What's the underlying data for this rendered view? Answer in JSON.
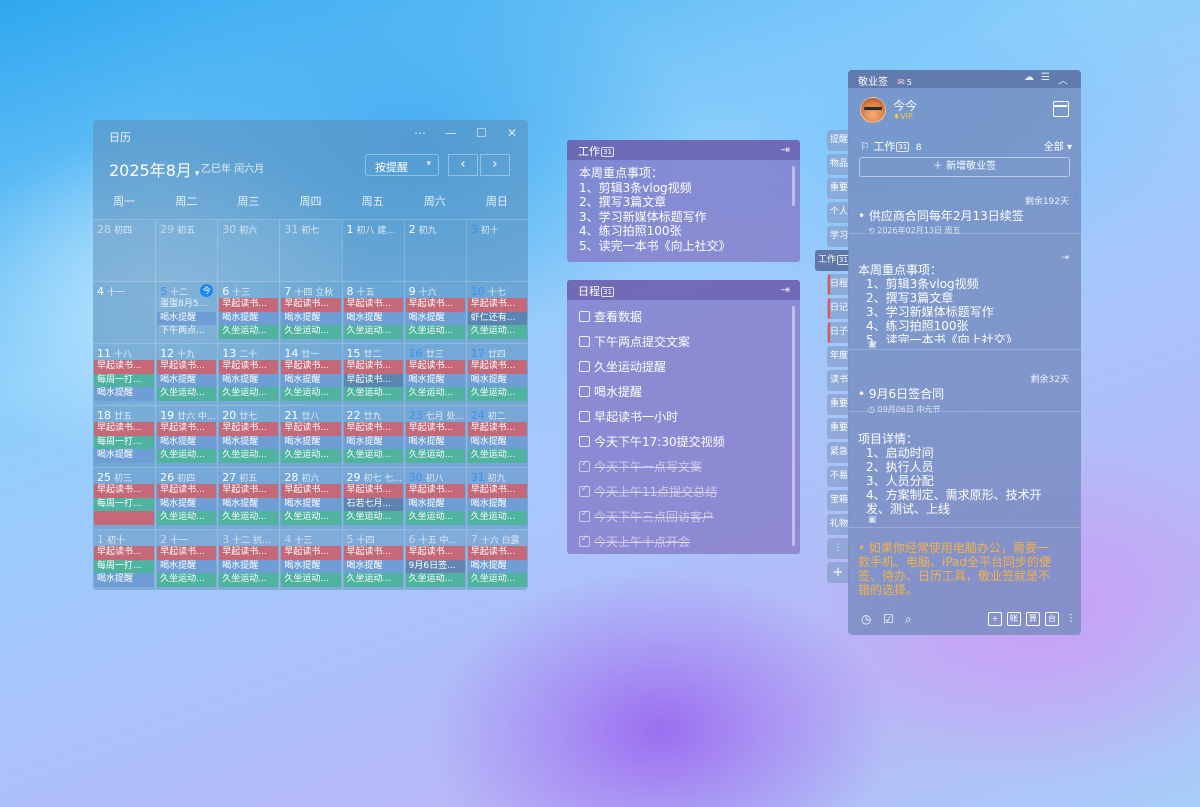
{
  "calendar": {
    "app_title": "日历",
    "window_controls": [
      "⋯",
      "—",
      "☐",
      "✕"
    ],
    "month": "2025年8月",
    "month_caret": "▾",
    "lunar": "乙巳年 闰六月",
    "filter": "按提醒",
    "filter_caret": "▾",
    "nav_prev": "‹",
    "nav_next": "›",
    "weekdays": [
      "周一",
      "周二",
      "周三",
      "周四",
      "周五",
      "周六",
      "周日"
    ],
    "weeks": [
      [
        {
          "d": "28",
          "l": "初四",
          "dim": true,
          "ev": []
        },
        {
          "d": "29",
          "l": "初五",
          "dim": true,
          "ev": []
        },
        {
          "d": "30",
          "l": "初六",
          "dim": true,
          "ev": []
        },
        {
          "d": "31",
          "l": "初七",
          "dim": true,
          "ev": []
        },
        {
          "d": "1",
          "l": "初八 建...",
          "ev": []
        },
        {
          "d": "2",
          "l": "初九",
          "ev": []
        },
        {
          "d": "3",
          "l": "初十",
          "wk": true,
          "ev": []
        }
      ],
      [
        {
          "d": "4",
          "l": "十一",
          "ev": []
        },
        {
          "d": "5",
          "l": "十二",
          "wk": true,
          "badge": "今",
          "ev": [
            {
              "t": "蛋蛋8月5...",
              "c": "none"
            },
            {
              "t": "喝水提醒",
              "c": "blue"
            },
            {
              "t": "下午两点...",
              "c": "none"
            }
          ]
        },
        {
          "d": "6",
          "l": "十三",
          "ev": [
            {
              "t": "早起读书...",
              "c": "red"
            },
            {
              "t": "喝水提醒",
              "c": "blue"
            },
            {
              "t": "久坐运动...",
              "c": "teal"
            }
          ]
        },
        {
          "d": "7",
          "l": "十四 立秋",
          "ev": [
            {
              "t": "早起读书...",
              "c": "red"
            },
            {
              "t": "喝水提醒",
              "c": "blue"
            },
            {
              "t": "久坐运动...",
              "c": "teal"
            }
          ]
        },
        {
          "d": "8",
          "l": "十五",
          "ev": [
            {
              "t": "早起读书...",
              "c": "red"
            },
            {
              "t": "喝水提醒",
              "c": "blue"
            },
            {
              "t": "久坐运动...",
              "c": "teal"
            }
          ]
        },
        {
          "d": "9",
          "l": "十六",
          "ev": [
            {
              "t": "早起读书...",
              "c": "red"
            },
            {
              "t": "喝水提醒",
              "c": "blue"
            },
            {
              "t": "久坐运动...",
              "c": "teal"
            }
          ]
        },
        {
          "d": "10",
          "l": "十七",
          "wk": true,
          "ev": [
            {
              "t": "早起读书...",
              "c": "red"
            },
            {
              "t": "虾仁还有...",
              "c": "grey"
            },
            {
              "t": "久坐运动...",
              "c": "teal"
            }
          ]
        }
      ],
      [
        {
          "d": "11",
          "l": "十八",
          "ev": [
            {
              "t": "早起读书...",
              "c": "red"
            },
            {
              "t": "每周一打...",
              "c": "teal"
            },
            {
              "t": "喝水提醒",
              "c": "blue"
            }
          ]
        },
        {
          "d": "12",
          "l": "十九",
          "ev": [
            {
              "t": "早起读书...",
              "c": "red"
            },
            {
              "t": "喝水提醒",
              "c": "blue"
            },
            {
              "t": "久坐运动...",
              "c": "teal"
            }
          ]
        },
        {
          "d": "13",
          "l": "二十",
          "ev": [
            {
              "t": "早起读书...",
              "c": "red"
            },
            {
              "t": "喝水提醒",
              "c": "blue"
            },
            {
              "t": "久坐运动...",
              "c": "teal"
            }
          ]
        },
        {
          "d": "14",
          "l": "廿一",
          "ev": [
            {
              "t": "早起读书...",
              "c": "red"
            },
            {
              "t": "喝水提醒",
              "c": "blue"
            },
            {
              "t": "久坐运动...",
              "c": "teal"
            }
          ]
        },
        {
          "d": "15",
          "l": "廿二",
          "ev": [
            {
              "t": "早起读书...",
              "c": "red"
            },
            {
              "t": "早起读书...",
              "c": "grey"
            },
            {
              "t": "久坐运动...",
              "c": "teal"
            }
          ]
        },
        {
          "d": "16",
          "l": "廿三",
          "wk": true,
          "ev": [
            {
              "t": "早起读书...",
              "c": "red"
            },
            {
              "t": "喝水提醒",
              "c": "blue"
            },
            {
              "t": "久坐运动...",
              "c": "teal"
            }
          ]
        },
        {
          "d": "17",
          "l": "廿四",
          "wk": true,
          "ev": [
            {
              "t": "早起读书...",
              "c": "red"
            },
            {
              "t": "喝水提醒",
              "c": "blue"
            },
            {
              "t": "久坐运动...",
              "c": "teal"
            }
          ]
        }
      ],
      [
        {
          "d": "18",
          "l": "廿五",
          "ev": [
            {
              "t": "早起读书...",
              "c": "red"
            },
            {
              "t": "每周一打...",
              "c": "teal"
            },
            {
              "t": "喝水提醒",
              "c": "blue"
            }
          ]
        },
        {
          "d": "19",
          "l": "廿六 中...",
          "ev": [
            {
              "t": "早起读书...",
              "c": "red"
            },
            {
              "t": "喝水提醒",
              "c": "blue"
            },
            {
              "t": "久坐运动...",
              "c": "teal"
            }
          ]
        },
        {
          "d": "20",
          "l": "廿七",
          "ev": [
            {
              "t": "早起读书...",
              "c": "red"
            },
            {
              "t": "喝水提醒",
              "c": "blue"
            },
            {
              "t": "久坐运动...",
              "c": "teal"
            }
          ]
        },
        {
          "d": "21",
          "l": "廿八",
          "ev": [
            {
              "t": "早起读书...",
              "c": "red"
            },
            {
              "t": "喝水提醒",
              "c": "blue"
            },
            {
              "t": "久坐运动...",
              "c": "teal"
            }
          ]
        },
        {
          "d": "22",
          "l": "廿九",
          "ev": [
            {
              "t": "早起读书...",
              "c": "red"
            },
            {
              "t": "喝水提醒",
              "c": "blue"
            },
            {
              "t": "久坐运动...",
              "c": "teal"
            }
          ]
        },
        {
          "d": "23",
          "l": "七月 处...",
          "wk": true,
          "ev": [
            {
              "t": "早起读书...",
              "c": "red"
            },
            {
              "t": "喝水提醒",
              "c": "blue"
            },
            {
              "t": "久坐运动...",
              "c": "teal"
            }
          ]
        },
        {
          "d": "24",
          "l": "初二",
          "wk": true,
          "ev": [
            {
              "t": "早起读书...",
              "c": "red"
            },
            {
              "t": "喝水提醒",
              "c": "blue"
            },
            {
              "t": "久坐运动...",
              "c": "teal"
            }
          ]
        }
      ],
      [
        {
          "d": "25",
          "l": "初三",
          "ev": [
            {
              "t": "早起读书...",
              "c": "red"
            },
            {
              "t": "每周一打...",
              "c": "teal"
            },
            {
              "t": "",
              "c": "red"
            }
          ]
        },
        {
          "d": "26",
          "l": "初四",
          "ev": [
            {
              "t": "早起读书...",
              "c": "red"
            },
            {
              "t": "喝水提醒",
              "c": "blue"
            },
            {
              "t": "久坐运动...",
              "c": "teal"
            }
          ]
        },
        {
          "d": "27",
          "l": "初五",
          "ev": [
            {
              "t": "早起读书...",
              "c": "red"
            },
            {
              "t": "喝水提醒",
              "c": "blue"
            },
            {
              "t": "久坐运动...",
              "c": "teal"
            }
          ]
        },
        {
          "d": "28",
          "l": "初六",
          "ev": [
            {
              "t": "早起读书...",
              "c": "red"
            },
            {
              "t": "喝水提醒",
              "c": "blue"
            },
            {
              "t": "久坐运动...",
              "c": "teal"
            }
          ]
        },
        {
          "d": "29",
          "l": "初七 七...",
          "ev": [
            {
              "t": "早起读书...",
              "c": "red"
            },
            {
              "t": "石若七月...",
              "c": "grey"
            },
            {
              "t": "久坐运动...",
              "c": "teal"
            }
          ]
        },
        {
          "d": "30",
          "l": "初八",
          "wk": true,
          "ev": [
            {
              "t": "早起读书...",
              "c": "red"
            },
            {
              "t": "喝水提醒",
              "c": "blue"
            },
            {
              "t": "久坐运动...",
              "c": "teal"
            }
          ]
        },
        {
          "d": "31",
          "l": "初九",
          "wk": true,
          "ev": [
            {
              "t": "早起读书...",
              "c": "red"
            },
            {
              "t": "喝水提醒",
              "c": "blue"
            },
            {
              "t": "久坐运动...",
              "c": "teal"
            }
          ]
        }
      ],
      [
        {
          "d": "1",
          "l": "初十",
          "dim": true,
          "ev": [
            {
              "t": "早起读书...",
              "c": "red"
            },
            {
              "t": "每周一打...",
              "c": "teal"
            },
            {
              "t": "喝水提醒",
              "c": "blue"
            }
          ]
        },
        {
          "d": "2",
          "l": "十一",
          "dim": true,
          "ev": [
            {
              "t": "早起读书...",
              "c": "red"
            },
            {
              "t": "喝水提醒",
              "c": "blue"
            },
            {
              "t": "久坐运动...",
              "c": "teal"
            }
          ]
        },
        {
          "d": "3",
          "l": "十二 抗...",
          "dim": true,
          "ev": [
            {
              "t": "早起读书...",
              "c": "red"
            },
            {
              "t": "喝水提醒",
              "c": "blue"
            },
            {
              "t": "久坐运动...",
              "c": "teal"
            }
          ]
        },
        {
          "d": "4",
          "l": "十三",
          "dim": true,
          "ev": [
            {
              "t": "早起读书...",
              "c": "red"
            },
            {
              "t": "喝水提醒",
              "c": "blue"
            },
            {
              "t": "久坐运动...",
              "c": "teal"
            }
          ]
        },
        {
          "d": "5",
          "l": "十四",
          "dim": true,
          "ev": [
            {
              "t": "早起读书...",
              "c": "red"
            },
            {
              "t": "喝水提醒",
              "c": "blue"
            },
            {
              "t": "久坐运动...",
              "c": "teal"
            }
          ]
        },
        {
          "d": "6",
          "l": "十五 中...",
          "dim": true,
          "ev": [
            {
              "t": "早起读书...",
              "c": "red"
            },
            {
              "t": "9月6日签...",
              "c": "grey"
            },
            {
              "t": "久坐运动...",
              "c": "teal"
            }
          ]
        },
        {
          "d": "7",
          "l": "十六 白露",
          "dim": true,
          "ev": [
            {
              "t": "早起读书...",
              "c": "red"
            },
            {
              "t": "喝水提醒",
              "c": "blue"
            },
            {
              "t": "久坐运动...",
              "c": "teal"
            }
          ]
        }
      ]
    ]
  },
  "work_note": {
    "title": "工作",
    "cal_num": "31",
    "icon": "⇥",
    "lines": [
      "本周重点事项：",
      "1、剪辑3条vlog视频",
      "2、撰写3篇文章",
      "3、学习新媒体标题写作",
      "4、练习拍照100张",
      "5、读完一本书《向上社交》"
    ]
  },
  "schedule_note": {
    "title": "日程",
    "cal_num": "31",
    "icon": "⇥",
    "items": [
      {
        "t": "查看数据",
        "done": false
      },
      {
        "t": "下午两点提交文案",
        "done": false
      },
      {
        "t": "久坐运动提醒",
        "done": false
      },
      {
        "t": "喝水提醒",
        "done": false
      },
      {
        "t": "早起读书一小时",
        "done": false
      },
      {
        "t": "今天下午17:30提交视频",
        "done": false
      },
      {
        "t": "今天下午一点写文案",
        "done": true
      },
      {
        "t": "今天上午11点提交总结",
        "done": true
      },
      {
        "t": "今天下午三点回访客户",
        "done": true
      },
      {
        "t": "今天上午十点开会",
        "done": true
      }
    ]
  },
  "side_tabs": [
    "提醒",
    "物品",
    "重要",
    "个人",
    "学习",
    "工作",
    "日程",
    "日记",
    "日子",
    "年度",
    "读书",
    "重要",
    "重要",
    "紧急",
    "不易",
    "宝箱",
    "礼物"
  ],
  "side_tab_active": "工作",
  "side_more": "⋮",
  "side_add": "+",
  "panel": {
    "app": "敬业签",
    "count": "5",
    "top_icons": [
      "☁",
      "☰",
      "︿"
    ],
    "user": "今今",
    "vip": "VIP",
    "category": "工作",
    "cat_num": "31",
    "cat_count": "8",
    "filter": "全部 ▾",
    "add_label": "＋ 新增敬业签",
    "cards": [
      {
        "remain": "剩余192天",
        "title": "供应商合同每年2月13日续签",
        "sub": "2026年02月13日 周五"
      },
      {
        "lines": [
          "本周重点事项：",
          "1、剪辑3条vlog视频",
          "2、撰写3篇文章",
          "3、学习新媒体标题写作",
          "4、练习拍照100张",
          "5、读完一本书《向上社交》"
        ]
      },
      {
        "remain": "剩余32天",
        "title": "9月6日签合同",
        "sub": "09月06日 中元节"
      },
      {
        "lines": [
          "项目详情：",
          "1、启动时间",
          "2、执行人员",
          "3、人员分配",
          "4、方案制定、需求原形、技术开",
          "发、测试、上线"
        ]
      },
      {
        "orange": "如果你经常使用电脑办公，需要一款手机、电脑、iPad全平台同步的便签、待办、日历工具，敬业签就是不错的选择。"
      }
    ],
    "bottom_icons": [
      "◷",
      "☑",
      "⌕"
    ],
    "bottom_right": [
      "+",
      "帐",
      "算",
      "台"
    ]
  }
}
